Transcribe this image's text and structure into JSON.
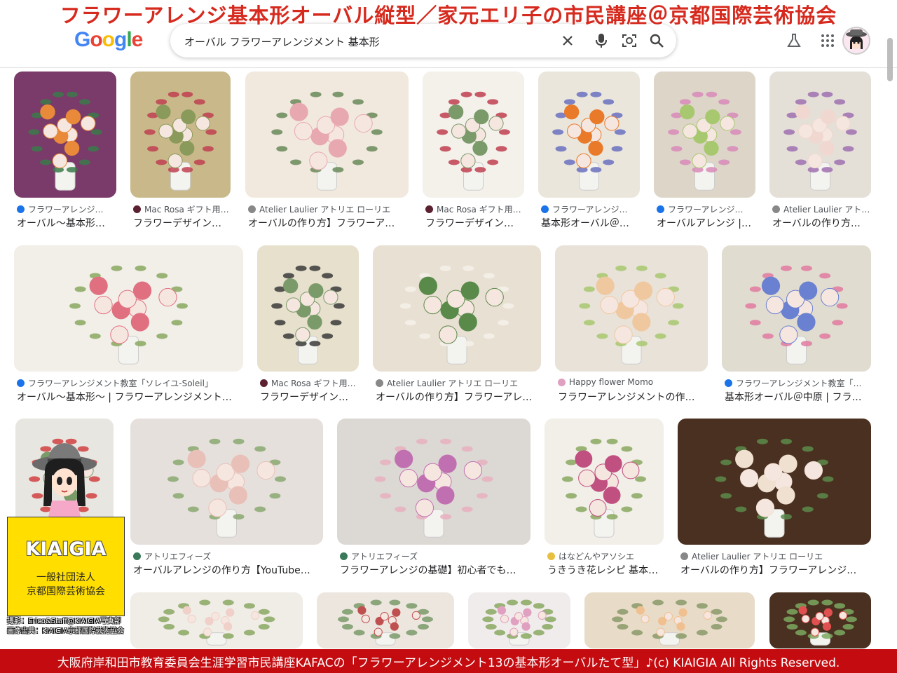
{
  "banner": {
    "title": "フラワーアレンジ基本形オーバル縦型／家元エリ子の市民講座＠京都国際芸術協会"
  },
  "header": {
    "logo_letters": [
      "G",
      "o",
      "o",
      "g",
      "l",
      "e"
    ],
    "search_value": "オーバル フラワーアレンジメント 基本形",
    "icons": [
      "close-icon",
      "microphone-icon",
      "lens-icon",
      "search-icon",
      "labs-flask-icon",
      "apps-grid-icon",
      "avatar"
    ]
  },
  "results": [
    {
      "source": "フラワーアレンジ…",
      "title": "オーバル〜基本形…",
      "fav": "#1a73e8",
      "colors": [
        "#7a3a6a",
        "#e98a3a",
        "#3b7a4a"
      ]
    },
    {
      "source": "Mac Rosa ギフト用…",
      "title": "フラワーデザイン…",
      "fav": "#5b2130",
      "colors": [
        "#c9b98a",
        "#8a9a5a",
        "#c04050"
      ]
    },
    {
      "source": "Atelier Laulier アトリエ ローリエ",
      "title": "オーバルの作り方】フラワーア…",
      "fav": "#888888",
      "colors": [
        "#f1e9de",
        "#e8a8b0",
        "#6a8a5a"
      ]
    },
    {
      "source": "Mac Rosa ギフト用…",
      "title": "フラワーデザイン…",
      "fav": "#5b2130",
      "colors": [
        "#f4f1ea",
        "#7a9a6a",
        "#c04050"
      ]
    },
    {
      "source": "フラワーアレンジ…",
      "title": "基本形オーバル＠…",
      "fav": "#1a73e8",
      "colors": [
        "#eae6dc",
        "#e87a2a",
        "#6a70c0"
      ]
    },
    {
      "source": "フラワーアレンジ…",
      "title": "オーバルアレンジ |…",
      "fav": "#1a73e8",
      "colors": [
        "#ddd6c8",
        "#a8c870",
        "#d88ab8"
      ]
    },
    {
      "source": "Atelier Laulier アト…",
      "title": "オーバルの作り方…",
      "fav": "#888888",
      "colors": [
        "#e4e0d8",
        "#f0d8d0",
        "#a070b0"
      ]
    },
    {
      "source": "フラワーアレンジメント教室「ソレイユ-Soleil」",
      "title": "オーバル〜基本形〜 | フラワーアレンジメント…",
      "fav": "#1a73e8",
      "colors": [
        "#f2eee8",
        "#e07080",
        "#8aa860"
      ]
    },
    {
      "source": "Mac Rosa ギフト用…",
      "title": "フラワーデザイン…",
      "fav": "#5b2130",
      "colors": [
        "#e6e0cc",
        "#7a9a6a",
        "#3a3a3a"
      ]
    },
    {
      "source": "Atelier Laulier アトリエ ローリエ",
      "title": "オーバルの作り方】フラワーアレ…",
      "fav": "#888888",
      "colors": [
        "#e8e0d2",
        "#5a8a4a",
        "#f4f0ea"
      ]
    },
    {
      "source": "Happy flower Momo",
      "title": "フラワーアレンジメントの作…",
      "fav": "#e0a0c0",
      "colors": [
        "#e8e2d8",
        "#f0c8a0",
        "#a8c870"
      ]
    },
    {
      "source": "フラワーアレンジメント教室「…",
      "title": "基本形オーバル＠中原 | フラ…",
      "fav": "#1a73e8",
      "colors": [
        "#e0dcd0",
        "#6a80d0",
        "#e07aa0"
      ]
    },
    {
      "source": "",
      "title": "",
      "fav": "#ffffff",
      "colors": [
        "#e8e6e0",
        "#7a9a6a",
        "#d04040"
      ]
    },
    {
      "source": "アトリエフィーズ",
      "title": "オーバルアレンジの作り方【YouTube…",
      "fav": "#3a7a5a",
      "colors": [
        "#e6e0dc",
        "#e8c0b8",
        "#8aa870"
      ]
    },
    {
      "source": "アトリエフィーズ",
      "title": "フラワーアレンジの基礎】初心者でも…",
      "fav": "#3a7a5a",
      "colors": [
        "#dcd8d4",
        "#c070b0",
        "#e8b0c0"
      ]
    },
    {
      "source": "はなどんやアソシエ",
      "title": "うきうき花レシピ 基本…",
      "fav": "#e8c040",
      "colors": [
        "#f2eee8",
        "#c05080",
        "#8aa860"
      ]
    },
    {
      "source": "Atelier Laulier アトリエ ローリエ",
      "title": "オーバルの作り方】フラワーアレンジ…",
      "fav": "#888888",
      "colors": [
        "#4a3020",
        "#f0e0d0",
        "#5a8a4a"
      ]
    },
    {
      "source": "",
      "title": "",
      "fav": "#ffffff",
      "colors": [
        "#f0ece6",
        "#f0d0c8",
        "#8aa860"
      ]
    },
    {
      "source": "",
      "title": "",
      "fav": "#ffffff",
      "colors": [
        "#ece6de",
        "#c05050",
        "#7a9a6a"
      ]
    },
    {
      "source": "",
      "title": "",
      "fav": "#ffffff",
      "colors": [
        "#f0ecec",
        "#e0a0c0",
        "#8aa860"
      ]
    },
    {
      "source": "",
      "title": "",
      "fav": "#ffffff",
      "colors": [
        "#e8dcc8",
        "#f0c090",
        "#8a9a6a"
      ]
    },
    {
      "source": "",
      "title": "",
      "fav": "#ffffff",
      "colors": [
        "#4a3020",
        "#e05050",
        "#7aa860"
      ]
    }
  ],
  "overlay": {
    "badge_name": "KIAIGIA",
    "badge_line1": "一般社団法人",
    "badge_line2": "京都国際芸術協会",
    "credit_line1": "撮影：Erico&Staff@KIAIGIA写真部",
    "credit_line2": "画像出典：KIAIGIA京都国際芸術協会",
    "footer": "大阪府岸和田市教育委員会生涯学習市民講座KAFACの「フラワーアレンジメント13の基本形オーバルたて型」♪(c) KIAIGIA All Rights Reserved."
  }
}
